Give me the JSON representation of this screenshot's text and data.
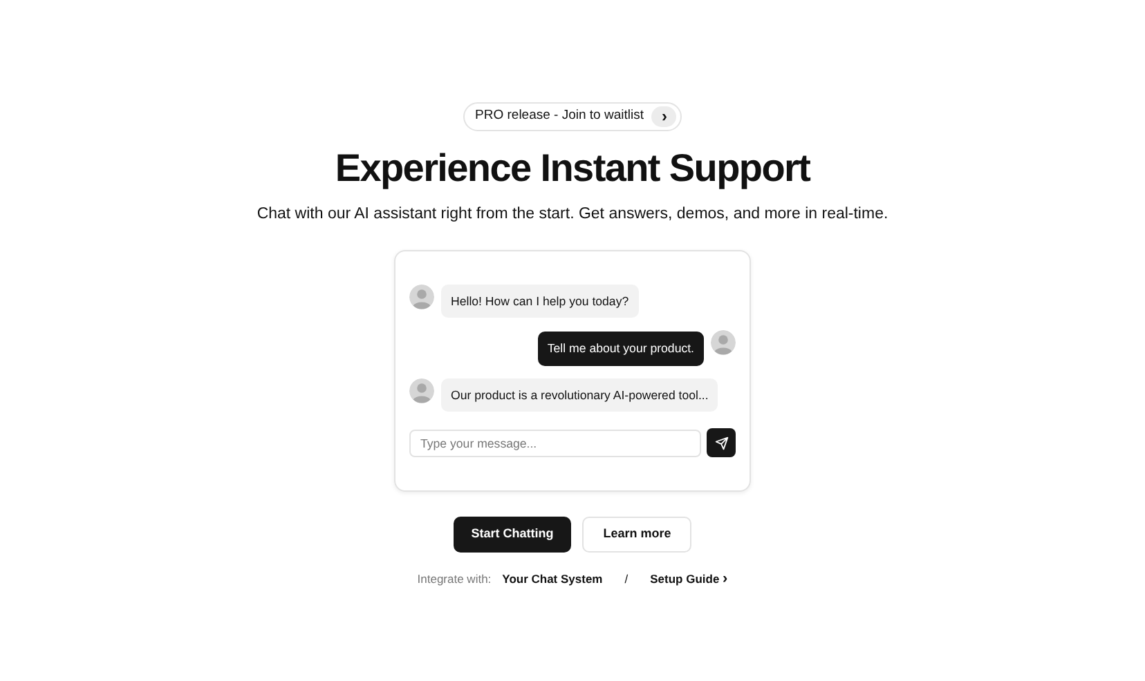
{
  "announcement": {
    "text": "PRO release - Join to waitlist",
    "arrow": "›"
  },
  "title": "Experience Instant Support",
  "subtitle": "Chat with our AI assistant right from the start. Get answers, demos, and more in real-time.",
  "chat": {
    "messages": [
      {
        "kind": "bot",
        "text": "Hello! How can I help you today?"
      },
      {
        "kind": "user",
        "text": "Tell me about your product."
      },
      {
        "kind": "bot",
        "text": "Our product is a revolutionary AI-powered tool..."
      }
    ],
    "input": {
      "placeholder": "Type your message..."
    }
  },
  "buttons": [
    {
      "label": "Start Chatting",
      "kind": "primary"
    },
    {
      "label": "Learn more",
      "kind": "outline"
    }
  ],
  "integrations": {
    "label": "Integrate with:",
    "items": [
      "Your Chat System",
      "Setup Guide"
    ],
    "separator": "/",
    "arrow": "›"
  }
}
